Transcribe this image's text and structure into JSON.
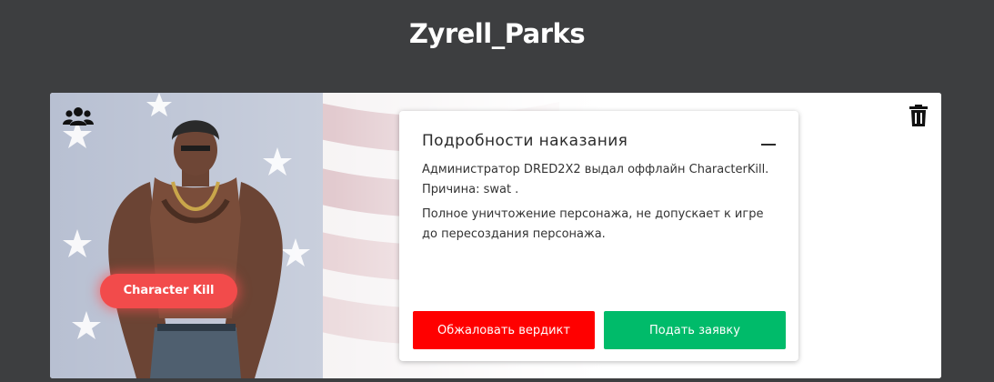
{
  "header": {
    "username": "Zyrell_Parks"
  },
  "icons": {
    "users": "users-icon",
    "trash": "trash-icon",
    "collapse": "minus-icon"
  },
  "profile": {
    "status_badge": "Character Kill",
    "status_color": "#f24b4b"
  },
  "punishment": {
    "title": "Подробности наказания",
    "message": "Администратор DRED2X2 выдал оффлайн CharacterKill. Причина: swat .",
    "description": "Полное уничтожение персонажа, не допускает к игре до пересоздания персонажа.",
    "appeal_label": "Обжаловать вердикт",
    "appeal_color": "#ff0000",
    "apply_label": "Подать заявку",
    "apply_color": "#00bb6a"
  }
}
